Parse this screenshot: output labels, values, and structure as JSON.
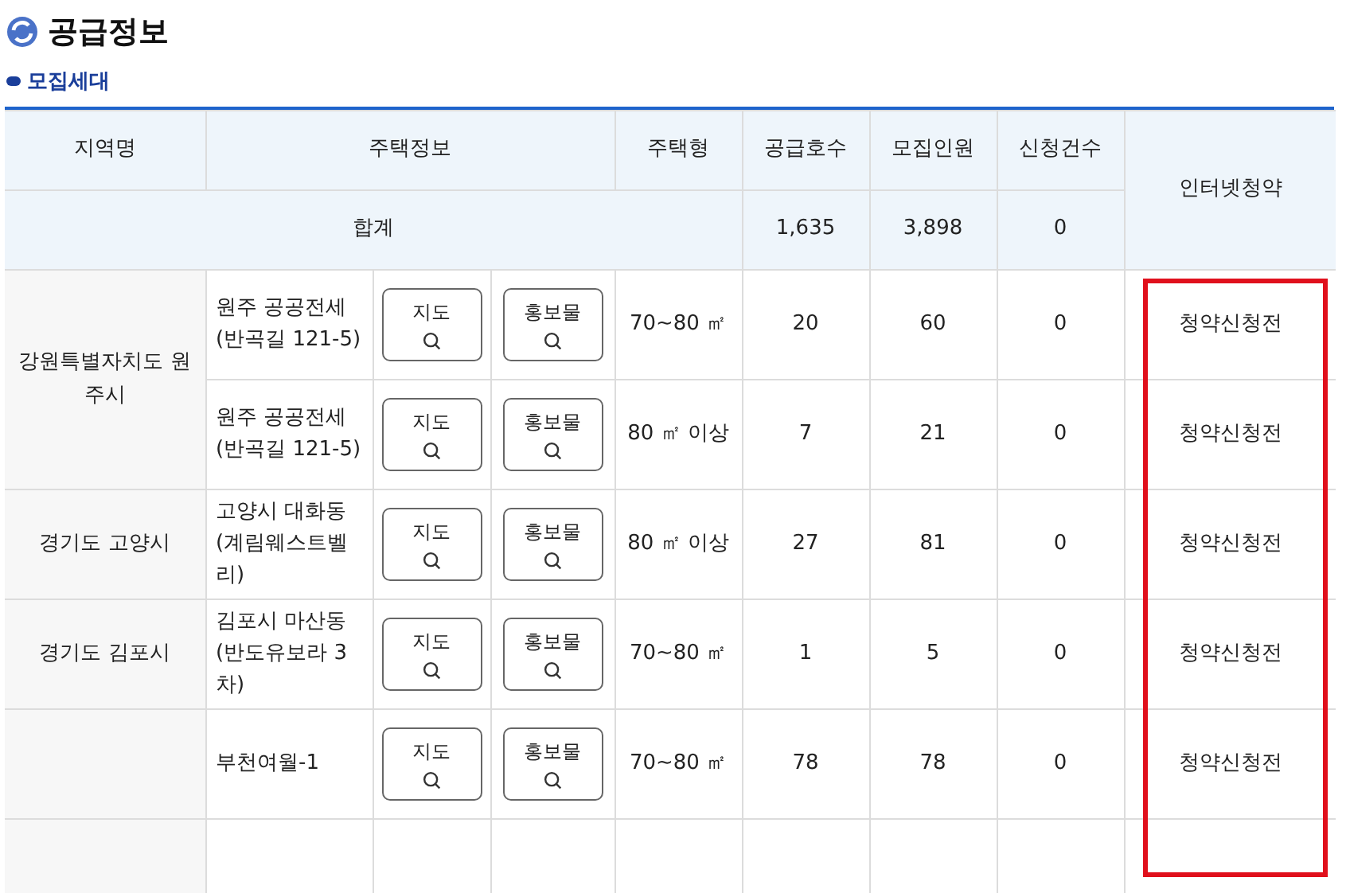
{
  "title": "공급정보",
  "subtitle": "모집세대",
  "table": {
    "columns": [
      "지역명",
      "주택정보",
      "주택형",
      "공급호수",
      "모집인원",
      "신청건수",
      "인터넷청약"
    ],
    "total": {
      "label": "합계",
      "supply": "1,635",
      "recruit": "3,898",
      "applications": "0"
    },
    "groups": [
      {
        "region": "강원특별자치도 원주시",
        "rows": [
          {
            "house": "원주 공공전세 (반곡길 121-5)",
            "map_button": "지도",
            "promo_button": "홍보물",
            "type": "70~80 ㎡",
            "supply": "20",
            "recruit": "60",
            "applications": "0",
            "status": "청약신청전"
          },
          {
            "house": "원주 공공전세 (반곡길 121-5)",
            "map_button": "지도",
            "promo_button": "홍보물",
            "type": "80 ㎡ 이상",
            "supply": "7",
            "recruit": "21",
            "applications": "0",
            "status": "청약신청전"
          }
        ]
      },
      {
        "region": "경기도 고양시",
        "rows": [
          {
            "house": "고양시 대화동 (계림웨스트벨리)",
            "map_button": "지도",
            "promo_button": "홍보물",
            "type": "80 ㎡ 이상",
            "supply": "27",
            "recruit": "81",
            "applications": "0",
            "status": "청약신청전"
          }
        ]
      },
      {
        "region": "경기도 김포시",
        "rows": [
          {
            "house": "김포시 마산동 (반도유보라 3차)",
            "map_button": "지도",
            "promo_button": "홍보물",
            "type": "70~80 ㎡",
            "supply": "1",
            "recruit": "5",
            "applications": "0",
            "status": "청약신청전"
          }
        ]
      },
      {
        "rows": [
          {
            "house": "부천여월-1",
            "map_button": "지도",
            "promo_button": "홍보물",
            "type": "70~80 ㎡",
            "supply": "78",
            "recruit": "78",
            "applications": "0",
            "status": "청약신청전"
          }
        ]
      }
    ]
  }
}
